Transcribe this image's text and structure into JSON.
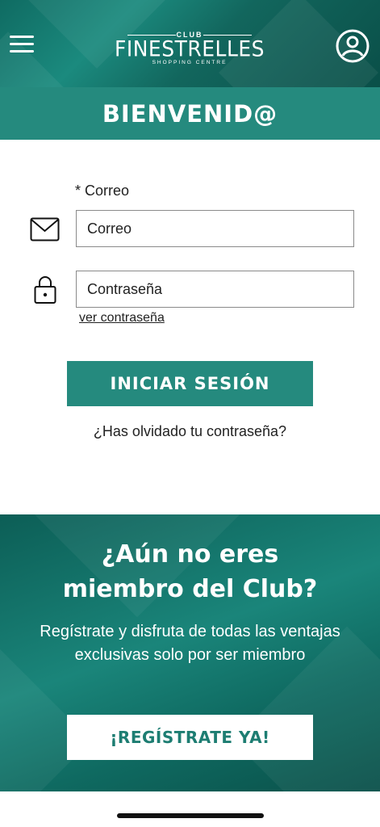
{
  "header": {
    "logo": {
      "club": "CLUB",
      "name": "FINESTRELLES",
      "subtitle": "SHOPPING CENTRE"
    },
    "menu_icon": "hamburger-icon",
    "user_icon": "user-circle-icon"
  },
  "welcome": {
    "title": "BIENVENID@"
  },
  "login_form": {
    "email_label": "* Correo",
    "email_placeholder": "Correo",
    "email_value": "",
    "email_icon": "envelope-icon",
    "password_placeholder": "Contraseña",
    "password_value": "",
    "password_icon": "lock-icon",
    "show_password": "ver contraseña",
    "submit_label": "INICIAR SESIÓN",
    "forgot_password": "¿Has olvidado tu contraseña?"
  },
  "promo": {
    "title_line1": "¿Aún no eres",
    "title_line2": "miembro del Club?",
    "description": "Regístrate y disfruta de todas las ventajas exclusivas solo por ser miembro",
    "register_label": "¡REGÍSTRATE YA!"
  },
  "colors": {
    "brand_teal": "#258a7e",
    "dark_teal": "#0c5e56",
    "register_text": "#1d7d72"
  }
}
